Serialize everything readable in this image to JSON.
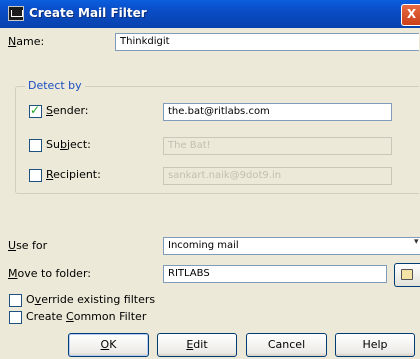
{
  "window": {
    "title": "Create Mail Filter",
    "close_glyph": "X"
  },
  "name": {
    "label": "Name:",
    "underline": "N",
    "rest": "ame:",
    "value": "Thinkdigit"
  },
  "detect_by": {
    "legend": "Detect by",
    "sender": {
      "underline": "S",
      "rest": "ender:",
      "checked": true,
      "value": "the.bat@ritlabs.com"
    },
    "subject": {
      "pre": "Su",
      "underline": "b",
      "rest": "ject:",
      "checked": false,
      "value": "The Bat!"
    },
    "recipient": {
      "underline": "R",
      "rest": "ecipient:",
      "checked": false,
      "value": "sankart.naik@9dot9.in"
    }
  },
  "use_for": {
    "underline": "U",
    "rest": "se for",
    "value": "Incoming mail"
  },
  "move_to": {
    "underline": "M",
    "rest": "ove to folder:",
    "value": "RITLABS"
  },
  "options": {
    "override": {
      "pre": "O",
      "underline": "v",
      "rest": "erride existing filters",
      "checked": false
    },
    "common": {
      "pre": "Create ",
      "underline": "C",
      "rest": "ommon Filter",
      "checked": false
    }
  },
  "buttons": {
    "ok": {
      "underline": "O",
      "rest": "K"
    },
    "edit": {
      "underline": "E",
      "rest": "dit"
    },
    "cancel": "Cancel",
    "help": "Help"
  },
  "icons": {
    "app": "mail-filter-icon",
    "close": "close-icon",
    "dropdown": "chevron-down-icon",
    "browse": "folder-browse-icon"
  },
  "colors": {
    "titlebar": "#0a4cc5",
    "close": "#d84e24",
    "legend": "#1c4ec2",
    "face": "#ece9d8"
  }
}
